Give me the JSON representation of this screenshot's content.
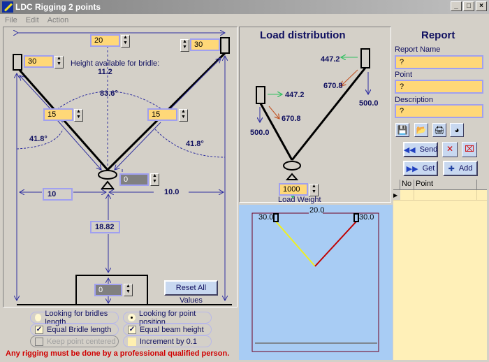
{
  "window": {
    "title": "LDC Rigging 2 points",
    "min": "_",
    "max": "□",
    "close": "×"
  },
  "menu": [
    "File",
    "Edit",
    "Action"
  ],
  "rigging": {
    "beam_distance": "20",
    "left_point_height": "30",
    "right_point_height": "30",
    "height_available_label": "Height available for bridle:",
    "height_available_value": "11.2",
    "angle_top": "83.6°",
    "angle_left": "41.8°",
    "angle_right": "41.8°",
    "left_bridle": "15",
    "right_bridle": "15",
    "point_offset": "0",
    "left_distance": "10",
    "right_distance": "10.0",
    "point_height": "18.82",
    "ground_offset": "0",
    "reset_label": "Reset All Values"
  },
  "options": {
    "looking_bridles": "Looking for bridles length",
    "looking_point": "Looking for point position",
    "equal_bridle": "Equal Bridle length",
    "equal_beam": "Equal beam height",
    "keep_centered": "Keep point centered",
    "increment": "Increment by 0.1",
    "selected_mode": "point",
    "equal_bridle_checked": true,
    "equal_beam_checked": true,
    "keep_centered_checked": false,
    "increment_checked": false
  },
  "warning": "Any rigging must be done by a professional qualified person.",
  "load": {
    "title": "Load distribution",
    "left_horizontal": "447.2",
    "right_horizontal": "447.2",
    "left_tension": "670.8",
    "right_tension": "670.8",
    "left_vertical": "500.0",
    "right_vertical": "500.0",
    "load_weight": "1000",
    "load_weight_label": "Load Weight"
  },
  "preview": {
    "top": "20.0",
    "left": "30.0",
    "right": "30.0"
  },
  "report": {
    "title": "Report",
    "name_label": "Report Name",
    "name_value": "?",
    "point_label": "Point",
    "point_value": "?",
    "desc_label": "Description",
    "desc_value": "?",
    "send": "Send",
    "get": "Get",
    "add": "Add",
    "table_headers": [
      "No",
      "Point"
    ]
  },
  "colors": {
    "accent": "#101060",
    "input": "#ffd878",
    "warning": "#d00000",
    "preview_bg": "#a8ccf4",
    "report_bg": "#fff0b8"
  }
}
